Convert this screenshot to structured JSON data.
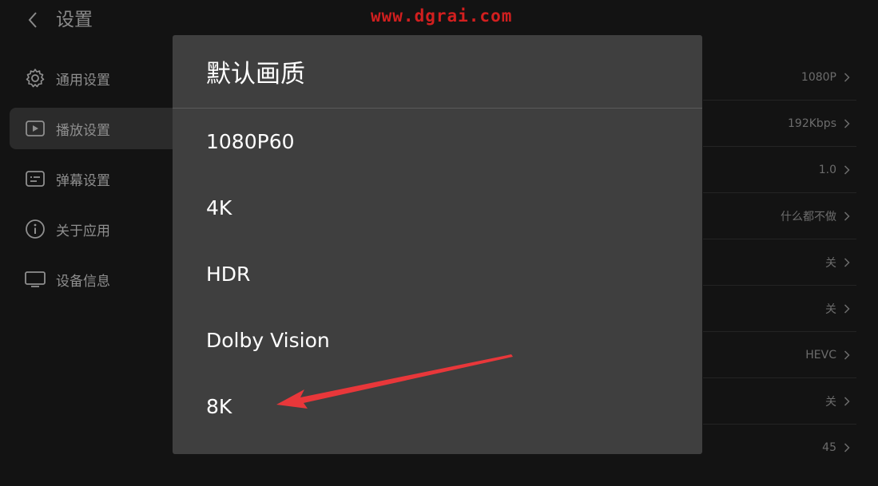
{
  "header": {
    "back_icon": "chevron-left-icon",
    "title": "设置",
    "watermark": "www.dgrai.com"
  },
  "sidebar": {
    "items": [
      {
        "label": "通用设置",
        "icon": "gear-icon",
        "active": false
      },
      {
        "label": "播放设置",
        "icon": "play-icon",
        "active": true
      },
      {
        "label": "弹幕设置",
        "icon": "danmaku-icon",
        "active": false
      },
      {
        "label": "关于应用",
        "icon": "info-icon",
        "active": false
      },
      {
        "label": "设备信息",
        "icon": "tv-icon",
        "active": false
      }
    ]
  },
  "settings_values": [
    "1080P",
    "192Kbps",
    "1.0",
    "什么都不做",
    "关",
    "关",
    "HEVC",
    "关",
    "45"
  ],
  "dialog": {
    "title": "默认画质",
    "options": [
      "1080P60",
      "4K",
      "HDR",
      "Dolby Vision",
      "8K"
    ]
  },
  "colors": {
    "background": "#131313",
    "dialog": "#3f3f3f",
    "arrow": "#e8373a",
    "watermark": "#d21f1f"
  }
}
